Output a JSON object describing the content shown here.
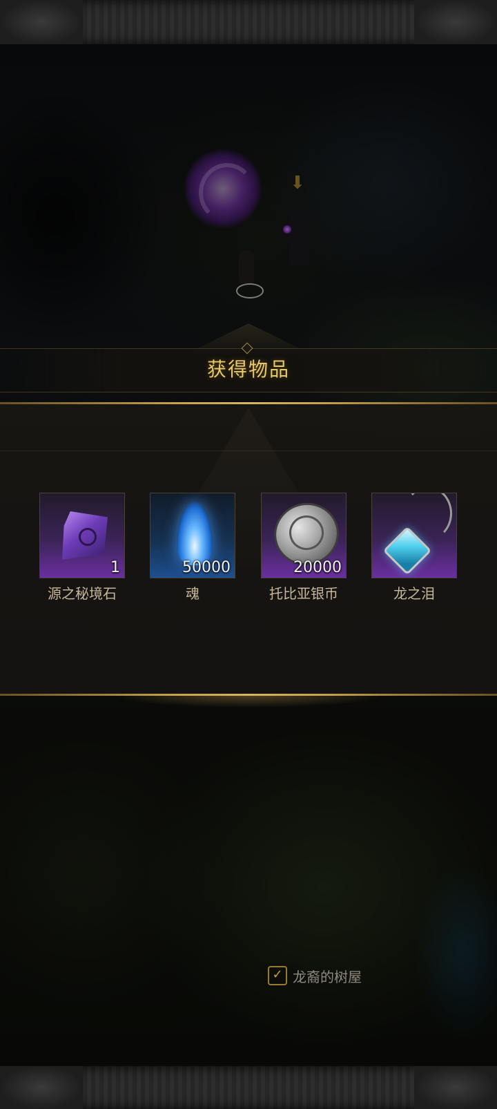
{
  "dialog": {
    "title": "获得物品"
  },
  "rewards": [
    {
      "name": "源之秘境石",
      "quantity": "1",
      "icon": "purple-stone-icon",
      "rarity_color": "#6a2fa0"
    },
    {
      "name": "魂",
      "quantity": "50000",
      "icon": "blue-soul-flame-icon",
      "rarity_color": "#1d4f8f"
    },
    {
      "name": "托比亚银币",
      "quantity": "20000",
      "icon": "silver-coin-icon",
      "rarity_color": "#6a2fa0"
    },
    {
      "name": "龙之泪",
      "quantity": "",
      "icon": "dragon-tear-pendant-icon",
      "rarity_color": "#6a2fa0"
    }
  ],
  "map": {
    "location_label": "龙裔的树屋",
    "marker_icon": "quest-marker-icon"
  },
  "colors": {
    "title_gold": "#e9c868",
    "border_gold": "#c9a04e",
    "item_name": "#c8b79a"
  }
}
